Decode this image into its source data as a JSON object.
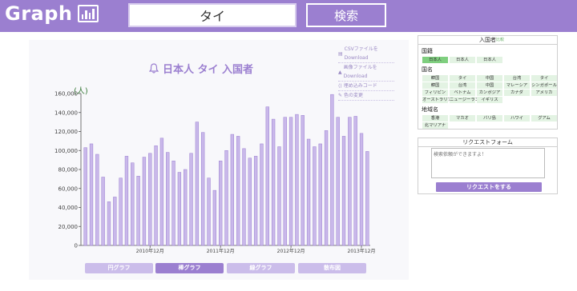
{
  "header": {
    "logo_text": "Graph",
    "search_value": "タイ",
    "search_button": "検索"
  },
  "downloads": {
    "csv": "CSVファイルをDownload",
    "image": "画像ファイルをDownload",
    "embed": "埋め込みコード",
    "color": "色の変更"
  },
  "chart_data": {
    "type": "bar",
    "title": "日本人 タイ 入国者",
    "ylabel": "(人)",
    "ylim": [
      0,
      160000
    ],
    "yticks": [
      "160,000",
      "140,000",
      "120,000",
      "100,000",
      "80,000",
      "60,000",
      "40,000",
      "20,000",
      "0"
    ],
    "xtick_labels": [
      {
        "index": 11,
        "label": "2010年12月"
      },
      {
        "index": 23,
        "label": "2011年12月"
      },
      {
        "index": 35,
        "label": "2012年12月"
      },
      {
        "index": 47,
        "label": "2013年12月"
      }
    ],
    "values": [
      103000,
      107000,
      96000,
      72000,
      46000,
      51000,
      71000,
      94000,
      87000,
      73000,
      93000,
      97000,
      105000,
      113000,
      98000,
      89000,
      77000,
      80000,
      97000,
      130000,
      119000,
      71000,
      58000,
      89000,
      100000,
      117000,
      115000,
      102000,
      92000,
      94000,
      107000,
      146000,
      133000,
      104000,
      135000,
      135000,
      138000,
      137000,
      112000,
      104000,
      107000,
      121000,
      159000,
      135000,
      115000,
      135000,
      136000,
      118000,
      99000
    ],
    "bar_color": "#c9b8ea",
    "bar_border": "#9b7fd0"
  },
  "graph_tabs": [
    {
      "label": "円グラフ",
      "active": false
    },
    {
      "label": "棒グラフ",
      "active": true
    },
    {
      "label": "線グラフ",
      "active": false
    },
    {
      "label": "散布図",
      "active": false
    }
  ],
  "visitors_panel": {
    "title": "入国者",
    "compare_label": "比較",
    "section_nationality": "国籍",
    "nationality_chips": [
      {
        "label": "日本人",
        "selected": true
      },
      {
        "label": "日本人",
        "selected": false
      },
      {
        "label": "日本人",
        "selected": false
      }
    ],
    "section_country": "国名",
    "country_chips": [
      "韓国",
      "タイ",
      "中国",
      "台湾",
      "タイ",
      "韓国",
      "台湾",
      "中国",
      "マレーシア",
      "シンガポール",
      "フィリピン",
      "ベトナム",
      "カンボジア",
      "カナダ",
      "アメリカ",
      "オーストラリア",
      "ニュージーランド",
      "イギリス"
    ],
    "section_region": "地域名",
    "region_chips": [
      "香港",
      "マカオ",
      "バリ島",
      "ハワイ",
      "グアム",
      "北マリアナ"
    ]
  },
  "request_panel": {
    "title": "リクエストフォーム",
    "placeholder": "検索依頼ができますよ！",
    "button": "リクエストをする"
  },
  "colors": {
    "accent": "#9b7fd0",
    "chip": "#e3f3e3",
    "chip_selected": "#7fcf7f"
  }
}
